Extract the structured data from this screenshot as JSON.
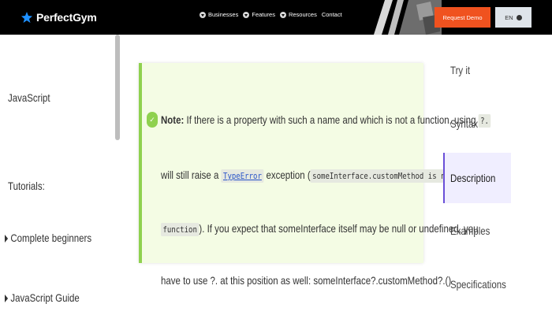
{
  "header": {
    "brand": "PerfectGym",
    "nav": [
      {
        "label": "Businesses",
        "icon": "chevron-down-icon"
      },
      {
        "label": "Features",
        "icon": "chevron-down-icon"
      },
      {
        "label": "Resources",
        "icon": "chevron-down-icon"
      }
    ],
    "contact": "Contact",
    "request_demo": "Request Demo",
    "language": "EN"
  },
  "sidebar": {
    "section_title": "JavaScript",
    "tutorials_label": "Tutorials:",
    "items": [
      {
        "label": "Complete beginners"
      },
      {
        "label": "JavaScript Guide"
      }
    ]
  },
  "note": {
    "label": "Note:",
    "line1": "If there is a property with such a name and which is not a function, using",
    "line1_code": "?.",
    "line2_start": "will still raise a",
    "line2_link": "TypeError",
    "line2_mid": "exception (",
    "line2_code": "someInterface.customMethod is not a",
    "line3_code": "function",
    "line3_rest": "). If you expect that someInterface itself may be null or undefined, you",
    "line4": "have to use ?. at this position as well: someInterface?.customMethod?.()"
  },
  "toc": {
    "items": [
      {
        "label": "Try it"
      },
      {
        "label": "Syntax"
      },
      {
        "label": "Description"
      },
      {
        "label": "Examples"
      },
      {
        "label": "Specifications"
      }
    ],
    "active": "Description"
  },
  "colors": {
    "accent": "#f0521f",
    "note_border": "#8fd14f",
    "active_toc": "#6a4fd8"
  }
}
